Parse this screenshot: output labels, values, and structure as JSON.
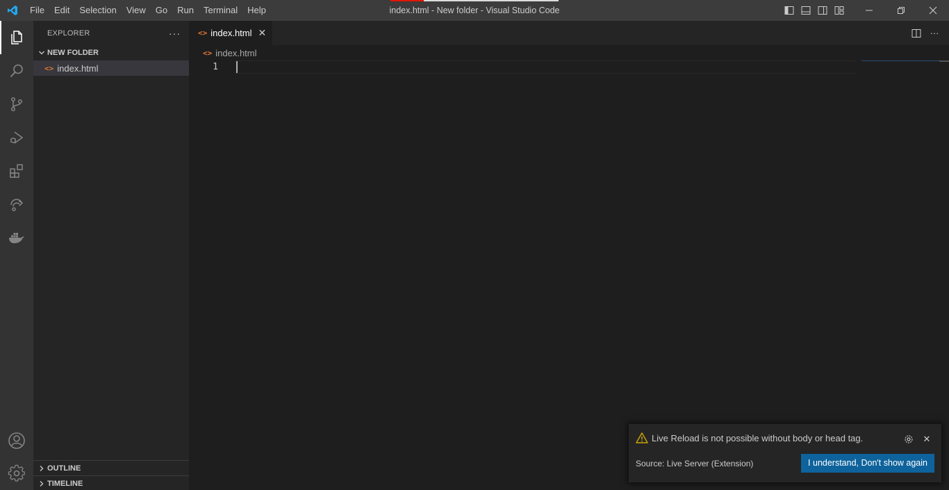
{
  "titlebar": {
    "menu": [
      "File",
      "Edit",
      "Selection",
      "View",
      "Go",
      "Run",
      "Terminal",
      "Help"
    ],
    "window_title": "index.html - New folder - Visual Studio Code",
    "accent_colors": {
      "error": "#e51400",
      "normal": "#dddddd"
    }
  },
  "activitybar": {
    "items": [
      "files-icon",
      "search-icon",
      "source-control-icon",
      "run-debug-icon",
      "extensions-icon",
      "remote-explorer-icon",
      "docker-icon"
    ],
    "bottom": [
      "account-icon",
      "settings-gear-icon"
    ]
  },
  "sidebar": {
    "title": "EXPLORER",
    "more": "···",
    "folder": "NEW FOLDER",
    "files": [
      "index.html"
    ],
    "outline": "OUTLINE",
    "timeline": "TIMELINE"
  },
  "editor": {
    "tab_label": "index.html",
    "tab_close": "✕",
    "more": "···",
    "breadcrumb": "index.html",
    "line_numbers": [
      "1"
    ],
    "file_icon_glyph": "<>"
  },
  "notification": {
    "message": "Live Reload is not possible without body or head tag.",
    "source": "Source: Live Server (Extension)",
    "button": "I understand, Don't show again",
    "close": "✕",
    "accent": "#0e639c",
    "warning_color": "#cca700"
  }
}
